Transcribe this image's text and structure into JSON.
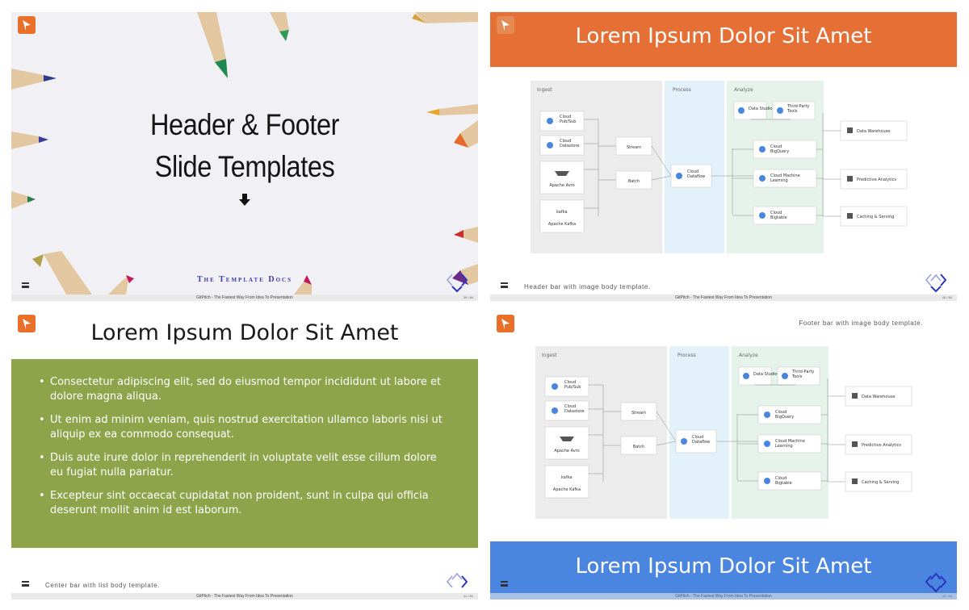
{
  "colors": {
    "accent_orange": "#e66f36",
    "accent_blue": "#4a86e0",
    "accent_green": "#8fa34a",
    "brand_navy": "#3a3aa8",
    "nav_arrow": "#3b43c8"
  },
  "common": {
    "footer_text": "GitPitch - The Fastest Way From Idea To Presentation",
    "menu_icon": "hamburger-menu-icon",
    "logo_icon": "gitpitch-logo-icon"
  },
  "slide1": {
    "title_line1": "Header & Footer",
    "title_line2": "Slide Templates",
    "brand": "The Template Docs",
    "page": "39 / 84"
  },
  "slide2": {
    "header": "Lorem Ipsum Dolor Sit Amet",
    "caption": "Header bar with image body template.",
    "page": "40 / 84"
  },
  "slide3": {
    "header": "Lorem Ipsum Dolor Sit Amet",
    "bullets": [
      "Consectetur adipiscing elit, sed do eiusmod tempor incididunt ut labore et dolore magna aliqua.",
      "Ut enim ad minim veniam, quis nostrud exercitation ullamco laboris nisi ut aliquip ex ea commodo consequat.",
      "Duis aute irure dolor in reprehenderit in voluptate velit esse cillum dolore eu fugiat nulla pariatur.",
      "Excepteur sint occaecat cupidatat non proident, sunt in culpa qui officia deserunt mollit anim id est laborum."
    ],
    "caption": "Center bar with list body template.",
    "page": "41 / 84"
  },
  "slide4": {
    "footer_bar": "Lorem Ipsum Dolor Sit Amet",
    "caption": "Footer bar with image body template.",
    "page": "42 / 84"
  },
  "diagram": {
    "sections": [
      "Ingest",
      "Process",
      "Analyze"
    ],
    "sources": [
      "Cloud Pub/Sub",
      "Cloud Datastore",
      "Apache Avro",
      "Apache Kafka"
    ],
    "kafka_logo": "kafka",
    "modes": [
      "Stream",
      "Batch"
    ],
    "process": "Cloud Dataflow",
    "analyze_top": [
      "Data Studio",
      "Third-Party Tools"
    ],
    "analyze": [
      "Cloud BigQuery",
      "Cloud Machine Learning",
      "Cloud Bigtable"
    ],
    "outputs": [
      "Data Warehouse",
      "Predictive Analytics",
      "Caching & Serving"
    ]
  }
}
